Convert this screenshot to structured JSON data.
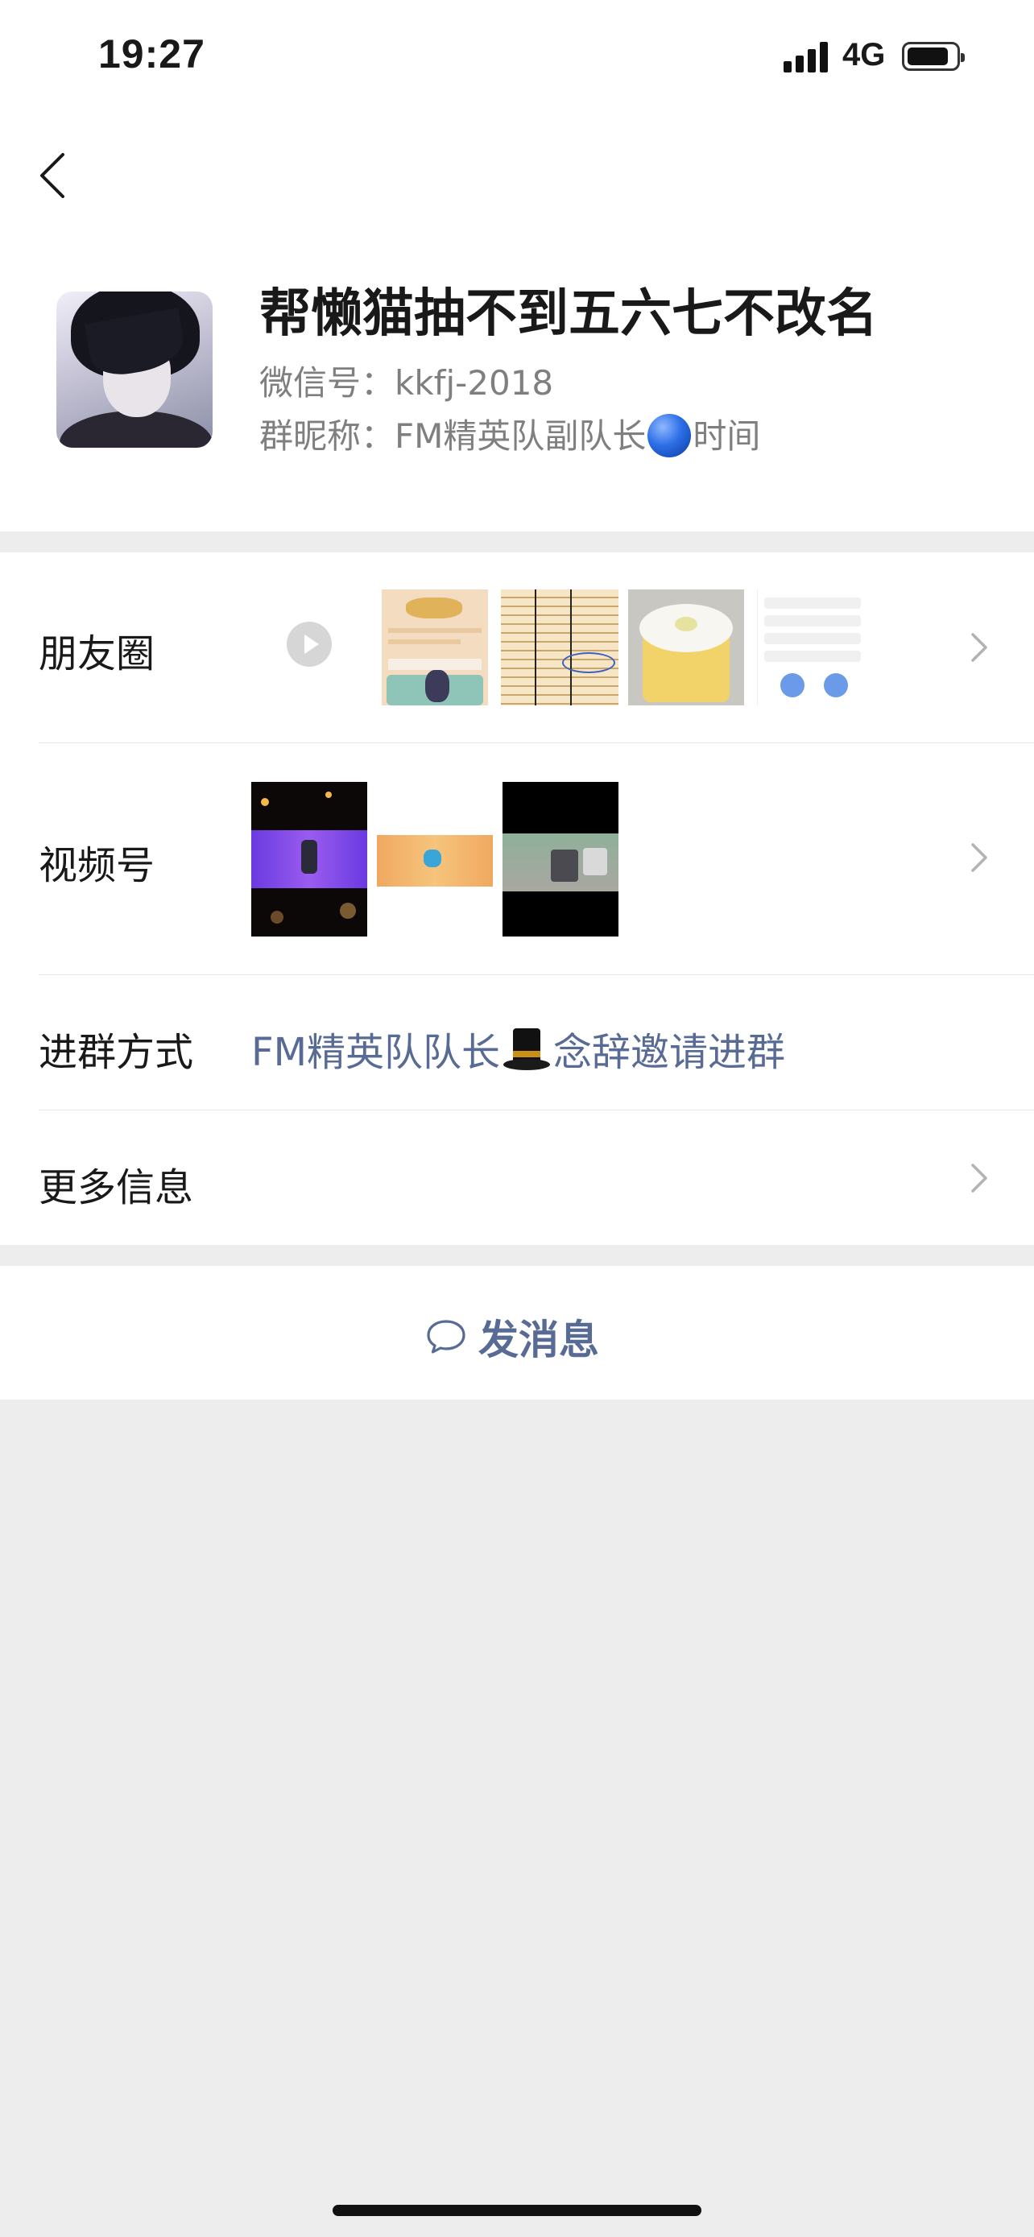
{
  "status_bar": {
    "time": "19:27",
    "network": "4G",
    "icons": [
      "signal-icon",
      "battery-icon"
    ]
  },
  "nav": {
    "back_icon": "chevron-left-icon"
  },
  "profile": {
    "name": "帮懒猫抽不到五六七不改名",
    "wechat_id_label": "微信号：",
    "wechat_id": "kkfj-2018",
    "group_nick_label": "群昵称：",
    "group_nick_prefix": "FM精英队副队长",
    "group_nick_emoji": "blue-circle",
    "group_nick_suffix": "时间"
  },
  "rows": {
    "moments": {
      "label": "朋友圈"
    },
    "channels": {
      "label": "视频号"
    },
    "join_method": {
      "label": "进群方式",
      "inviter_prefix": "FM精英队队长",
      "inviter_emoji": "top-hat",
      "inviter_suffix": "念辞",
      "action_text": "邀请进群"
    },
    "more_info": {
      "label": "更多信息"
    }
  },
  "send_message": {
    "label": "发消息",
    "icon": "chat-bubble-icon"
  },
  "colors": {
    "link": "#576b95",
    "background": "#ededed",
    "card": "#ffffff",
    "secondary_text": "#7f7f7f"
  }
}
